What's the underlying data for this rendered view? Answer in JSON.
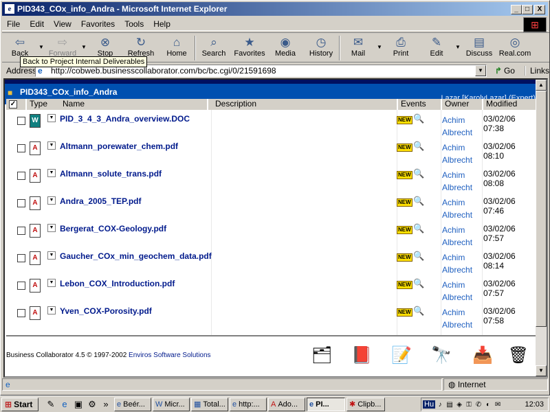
{
  "window": {
    "title": "PID343_COx_info_Andra - Microsoft Internet Explorer",
    "controls": [
      "_",
      "□",
      "X"
    ]
  },
  "menu": [
    "File",
    "Edit",
    "View",
    "Favorites",
    "Tools",
    "Help"
  ],
  "toolbar": {
    "back": "Back",
    "forward": "Forward",
    "stop": "Stop",
    "refresh": "Refresh",
    "home": "Home",
    "search": "Search",
    "favorites": "Favorites",
    "media": "Media",
    "history": "History",
    "mail": "Mail",
    "print": "Print",
    "edit": "Edit",
    "discuss": "Discuss",
    "realcom": "Real.com"
  },
  "tooltip": "Back to Project Internal Deliverables",
  "address": {
    "label": "Address",
    "url": "http://cobweb.businesscollaborator.com/bc/bc.cgi/0/21591698",
    "go": "Go",
    "links": "Links"
  },
  "page": {
    "folder_title": "PID343_COx_info_Andra",
    "user": "Lazar [KarolyLazar] (Expert)",
    "columns": {
      "type": "Type",
      "name": "Name",
      "description": "Description",
      "events": "Events",
      "owner": "Owner",
      "modified": "Modified"
    },
    "new_badge": "NEW",
    "files": [
      {
        "name": "PID_3_4_3_Andra_overview.DOC",
        "kind": "doc",
        "owner_first": "Achim",
        "owner_last": "Albrecht",
        "modified": "03/02/06 07:38"
      },
      {
        "name": "Altmann_porewater_chem.pdf",
        "kind": "pdf",
        "owner_first": "Achim",
        "owner_last": "Albrecht",
        "modified": "03/02/06 08:10"
      },
      {
        "name": "Altmann_solute_trans.pdf",
        "kind": "pdf",
        "owner_first": "Achim",
        "owner_last": "Albrecht",
        "modified": "03/02/06 08:08"
      },
      {
        "name": "Andra_2005_TEP.pdf",
        "kind": "pdf",
        "owner_first": "Achim",
        "owner_last": "Albrecht",
        "modified": "03/02/06 07:46"
      },
      {
        "name": "Bergerat_COX-Geology.pdf",
        "kind": "pdf",
        "owner_first": "Achim",
        "owner_last": "Albrecht",
        "modified": "03/02/06 07:57"
      },
      {
        "name": "Gaucher_COx_min_geochem_data.pdf",
        "kind": "pdf",
        "owner_first": "Achim",
        "owner_last": "Albrecht",
        "modified": "03/02/06 08:14"
      },
      {
        "name": "Lebon_COX_Introduction.pdf",
        "kind": "pdf",
        "owner_first": "Achim",
        "owner_last": "Albrecht",
        "modified": "03/02/06 07:57"
      },
      {
        "name": "Yven_COX-Porosity.pdf",
        "kind": "pdf",
        "owner_first": "Achim",
        "owner_last": "Albrecht",
        "modified": "03/02/06 07:58"
      }
    ],
    "footer": {
      "prefix": "Business Collaborator 4.5 © 1997-2002",
      "company": "Enviros Software Solutions"
    }
  },
  "status": {
    "zone": "Internet"
  },
  "taskbar": {
    "start": "Start",
    "tasks": [
      "Beér...",
      "Micr...",
      "Total...",
      "http:...",
      "Ado...",
      "PI...",
      "Clipb..."
    ],
    "lang": "Hu",
    "clock": "12:03"
  }
}
